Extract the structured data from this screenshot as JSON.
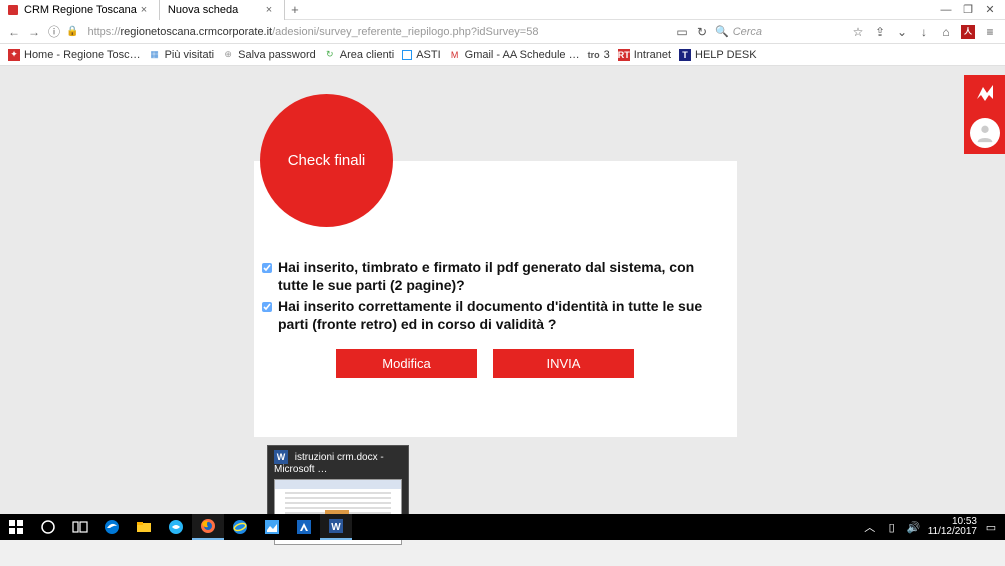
{
  "tabs": {
    "active": {
      "title": "CRM Regione Toscana"
    },
    "second": {
      "title": "Nuova scheda"
    }
  },
  "url": {
    "prefix": "https://",
    "domain": "regionetoscana.crmcorporate.it",
    "path": "/adesioni/survey_referente_riepilogo.php?idSurvey=58"
  },
  "search": {
    "placeholder": "Cerca"
  },
  "bookmarks": {
    "home": "Home - Regione Tosc…",
    "visited": "Più visitati",
    "salva": "Salva password",
    "area": "Area clienti",
    "asti": "ASTI",
    "gmail": "Gmail - AA Schedule …",
    "tre": "3",
    "intranet": "Intranet",
    "helpdesk": "HELP DESK"
  },
  "page": {
    "circle_title": "Check finali",
    "check1": "Hai inserito, timbrato e firmato il pdf generato dal sistema, con tutte le sue parti (2 pagine)?",
    "check2": "Hai inserito correttamente il documento d'identità in tutte le sue parti (fronte retro) ed in corso di validità ?",
    "modify": "Modifica",
    "send": "INVIA"
  },
  "task_preview": {
    "title": "istruzioni crm.docx - Microsoft …"
  },
  "clock": {
    "time": "10:53",
    "date": "11/12/2017"
  }
}
